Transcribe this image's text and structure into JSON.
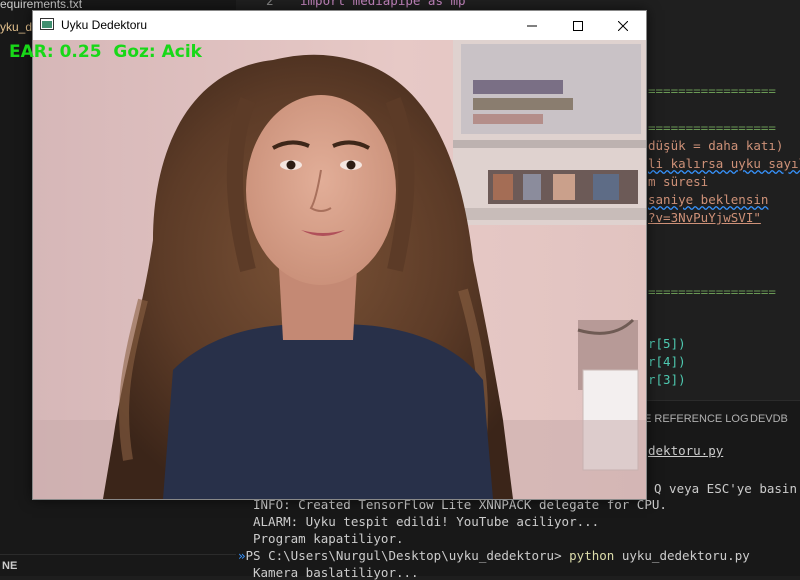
{
  "explorer": {
    "files": [
      "equirements.txt",
      "yku_d"
    ],
    "section_label": "NE"
  },
  "editor": {
    "line_number": "2",
    "import_line": "import mediapipe as mp",
    "rule": "=================",
    "lines": [
      "düşük = daha katı)",
      "li kalırsa uyku sayıl",
      "m süresi",
      "saniye beklensin",
      "?v=3NvPuYjwSVI\"",
      "r[5])",
      "r[4])",
      "r[3])"
    ]
  },
  "panel": {
    "tabs": [
      "E REFERENCE LOG",
      "DEVDB"
    ],
    "filename": "dektoru.py"
  },
  "terminal": {
    "lines": [
      "Q veya ESC'ye basin.",
      "INFO: Created TensorFlow Lite XNNPACK delegate for CPU.",
      "ALARM: Uyku tespit edildi! YouTube aciliyor...",
      "Program kapatiliyor.",
      "Kamera baslatiliyor..."
    ],
    "prompt": "PS C:\\Users\\Nurgul\\Desktop\\uyku_dedektoru>",
    "command": "python",
    "command_arg": "uyku_dedektoru.py"
  },
  "window": {
    "title": "Uyku Dedektoru",
    "overlay_ear": "EAR: 0.25",
    "overlay_eye": "Goz: Acik"
  },
  "colors": {
    "overlay_green": "#18d818",
    "editor_bg": "#1f1f1f",
    "command_yellow": "#dcdcaa"
  }
}
